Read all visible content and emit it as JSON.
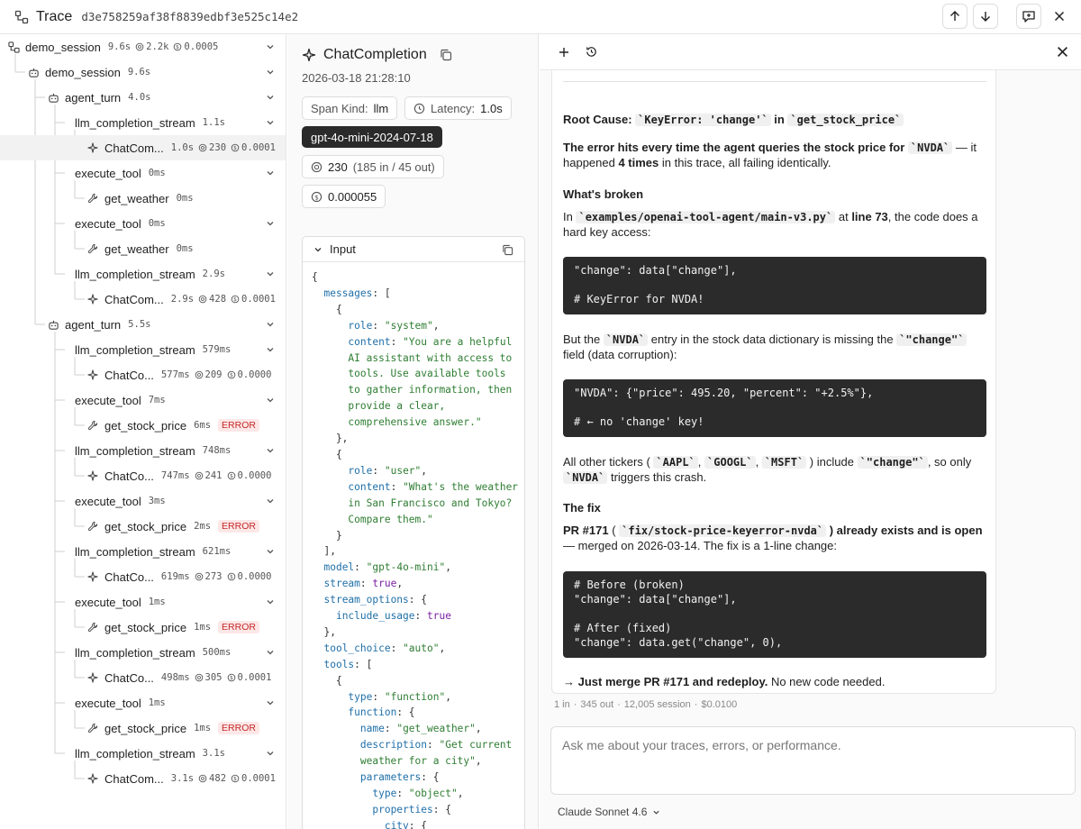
{
  "header": {
    "title": "Trace",
    "trace_id": "d3e758259af38f8839edbf3e525c14e2"
  },
  "tree": [
    {
      "name": "demo_session",
      "dur": "9.6s",
      "tokens": "2.2k",
      "cost": "0.0005",
      "icon": "session-icon",
      "chevron": true
    },
    {
      "name": "demo_session",
      "dur": "9.6s",
      "icon": "agent-icon",
      "chevron": true
    },
    {
      "name": "agent_turn",
      "dur": "4.0s",
      "icon": "agent-icon",
      "chevron": true
    },
    {
      "name": "llm_completion_stream",
      "dur": "1.1s",
      "icon": "branch-icon",
      "chevron": true
    },
    {
      "name": "ChatCom...",
      "dur": "1.0s",
      "tokens": "230",
      "cost": "0.0001",
      "icon": "sparkle-icon",
      "selected": true
    },
    {
      "name": "execute_tool",
      "dur": "0ms",
      "icon": "branch-icon",
      "chevron": true
    },
    {
      "name": "get_weather",
      "dur": "0ms",
      "icon": "wrench-icon"
    },
    {
      "name": "execute_tool",
      "dur": "0ms",
      "icon": "branch-icon",
      "chevron": true
    },
    {
      "name": "get_weather",
      "dur": "0ms",
      "icon": "wrench-icon"
    },
    {
      "name": "llm_completion_stream",
      "dur": "2.9s",
      "icon": "branch-icon",
      "chevron": true
    },
    {
      "name": "ChatCom...",
      "dur": "2.9s",
      "tokens": "428",
      "cost": "0.0001",
      "icon": "sparkle-icon"
    },
    {
      "name": "agent_turn",
      "dur": "5.5s",
      "icon": "agent-icon",
      "chevron": true
    },
    {
      "name": "llm_completion_stream",
      "dur": "579ms",
      "icon": "branch-icon",
      "chevron": true
    },
    {
      "name": "ChatCo...",
      "dur": "577ms",
      "tokens": "209",
      "cost": "0.0000",
      "icon": "sparkle-icon"
    },
    {
      "name": "execute_tool",
      "dur": "7ms",
      "icon": "branch-icon",
      "chevron": true
    },
    {
      "name": "get_stock_price",
      "dur": "6ms",
      "icon": "wrench-icon",
      "error": "ERROR"
    },
    {
      "name": "llm_completion_stream",
      "dur": "748ms",
      "icon": "branch-icon",
      "chevron": true
    },
    {
      "name": "ChatCo...",
      "dur": "747ms",
      "tokens": "241",
      "cost": "0.0000",
      "icon": "sparkle-icon"
    },
    {
      "name": "execute_tool",
      "dur": "3ms",
      "icon": "branch-icon",
      "chevron": true
    },
    {
      "name": "get_stock_price",
      "dur": "2ms",
      "icon": "wrench-icon",
      "error": "ERROR"
    },
    {
      "name": "llm_completion_stream",
      "dur": "621ms",
      "icon": "branch-icon",
      "chevron": true
    },
    {
      "name": "ChatCo...",
      "dur": "619ms",
      "tokens": "273",
      "cost": "0.0000",
      "icon": "sparkle-icon"
    },
    {
      "name": "execute_tool",
      "dur": "1ms",
      "icon": "branch-icon",
      "chevron": true
    },
    {
      "name": "get_stock_price",
      "dur": "1ms",
      "icon": "wrench-icon",
      "error": "ERROR"
    },
    {
      "name": "llm_completion_stream",
      "dur": "500ms",
      "icon": "branch-icon",
      "chevron": true
    },
    {
      "name": "ChatCo...",
      "dur": "498ms",
      "tokens": "305",
      "cost": "0.0001",
      "icon": "sparkle-icon"
    },
    {
      "name": "execute_tool",
      "dur": "1ms",
      "icon": "branch-icon",
      "chevron": true
    },
    {
      "name": "get_stock_price",
      "dur": "1ms",
      "icon": "wrench-icon",
      "error": "ERROR"
    },
    {
      "name": "llm_completion_stream",
      "dur": "3.1s",
      "icon": "branch-icon",
      "chevron": true
    },
    {
      "name": "ChatCom...",
      "dur": "3.1s",
      "tokens": "482",
      "cost": "0.0001",
      "icon": "sparkle-icon"
    }
  ],
  "span": {
    "name": "ChatCompletion",
    "timestamp": "2026-03-18 21:28:10",
    "kind_label": "Span Kind:",
    "kind_value": "llm",
    "latency_label": "Latency:",
    "latency_value": "1.0s",
    "model": "gpt-4o-mini-2024-07-18",
    "tokens_total": "230",
    "tokens_detail": "(185 in / 45 out)",
    "cost": "0.000055",
    "input_label": "Input"
  },
  "input_code": [
    [
      [
        "p",
        "{"
      ]
    ],
    [
      [
        "p",
        "  "
      ],
      [
        "k",
        "messages"
      ],
      [
        "p",
        ": ["
      ]
    ],
    [
      [
        "p",
        "    {"
      ]
    ],
    [
      [
        "p",
        "      "
      ],
      [
        "k",
        "role"
      ],
      [
        "p",
        ": "
      ],
      [
        "s",
        "\"system\""
      ],
      [
        "p",
        ","
      ]
    ],
    [
      [
        "p",
        "      "
      ],
      [
        "k",
        "content"
      ],
      [
        "p",
        ": "
      ],
      [
        "s",
        "\"You are a helpful"
      ]
    ],
    [
      [
        "s",
        "      AI assistant with access to"
      ]
    ],
    [
      [
        "s",
        "      tools. Use available tools"
      ]
    ],
    [
      [
        "s",
        "      to gather information, then"
      ]
    ],
    [
      [
        "s",
        "      provide a clear,"
      ]
    ],
    [
      [
        "s",
        "      comprehensive answer.\""
      ]
    ],
    [
      [
        "p",
        "    },"
      ]
    ],
    [
      [
        "p",
        "    {"
      ]
    ],
    [
      [
        "p",
        "      "
      ],
      [
        "k",
        "role"
      ],
      [
        "p",
        ": "
      ],
      [
        "s",
        "\"user\""
      ],
      [
        "p",
        ","
      ]
    ],
    [
      [
        "p",
        "      "
      ],
      [
        "k",
        "content"
      ],
      [
        "p",
        ": "
      ],
      [
        "s",
        "\"What's the weather"
      ]
    ],
    [
      [
        "s",
        "      in San Francisco and Tokyo?"
      ]
    ],
    [
      [
        "s",
        "      Compare them.\""
      ]
    ],
    [
      [
        "p",
        "    }"
      ]
    ],
    [
      [
        "p",
        "  ],"
      ]
    ],
    [
      [
        "p",
        "  "
      ],
      [
        "k",
        "model"
      ],
      [
        "p",
        ": "
      ],
      [
        "s",
        "\"gpt-4o-mini\""
      ],
      [
        "p",
        ","
      ]
    ],
    [
      [
        "p",
        "  "
      ],
      [
        "k",
        "stream"
      ],
      [
        "p",
        ": "
      ],
      [
        "kw",
        "true"
      ],
      [
        "p",
        ","
      ]
    ],
    [
      [
        "p",
        "  "
      ],
      [
        "k",
        "stream_options"
      ],
      [
        "p",
        ": {"
      ]
    ],
    [
      [
        "p",
        "    "
      ],
      [
        "k",
        "include_usage"
      ],
      [
        "p",
        ": "
      ],
      [
        "kw",
        "true"
      ]
    ],
    [
      [
        "p",
        "  },"
      ]
    ],
    [
      [
        "p",
        "  "
      ],
      [
        "k",
        "tool_choice"
      ],
      [
        "p",
        ": "
      ],
      [
        "s",
        "\"auto\""
      ],
      [
        "p",
        ","
      ]
    ],
    [
      [
        "p",
        "  "
      ],
      [
        "k",
        "tools"
      ],
      [
        "p",
        ": ["
      ]
    ],
    [
      [
        "p",
        "    {"
      ]
    ],
    [
      [
        "p",
        "      "
      ],
      [
        "k",
        "type"
      ],
      [
        "p",
        ": "
      ],
      [
        "s",
        "\"function\""
      ],
      [
        "p",
        ","
      ]
    ],
    [
      [
        "p",
        "      "
      ],
      [
        "k",
        "function"
      ],
      [
        "p",
        ": {"
      ]
    ],
    [
      [
        "p",
        "        "
      ],
      [
        "k",
        "name"
      ],
      [
        "p",
        ": "
      ],
      [
        "s",
        "\"get_weather\""
      ],
      [
        "p",
        ","
      ]
    ],
    [
      [
        "p",
        "        "
      ],
      [
        "k",
        "description"
      ],
      [
        "p",
        ": "
      ],
      [
        "s",
        "\"Get current"
      ]
    ],
    [
      [
        "s",
        "        weather for a city\""
      ],
      [
        "p",
        ","
      ]
    ],
    [
      [
        "p",
        "        "
      ],
      [
        "k",
        "parameters"
      ],
      [
        "p",
        ": {"
      ]
    ],
    [
      [
        "p",
        "          "
      ],
      [
        "k",
        "type"
      ],
      [
        "p",
        ": "
      ],
      [
        "s",
        "\"object\""
      ],
      [
        "p",
        ","
      ]
    ],
    [
      [
        "p",
        "          "
      ],
      [
        "k",
        "properties"
      ],
      [
        "p",
        ": {"
      ]
    ],
    [
      [
        "p",
        "            "
      ],
      [
        "k",
        "city"
      ],
      [
        "p",
        ": {"
      ]
    ]
  ],
  "chat": {
    "root_cause_prefix": "Root Cause: ",
    "root_cause_code1": "`KeyError: 'change'`",
    "root_cause_in": " in ",
    "root_cause_code2": "`get_stock_price`",
    "p1_a": "The error hits every time the agent queries the stock price for ",
    "p1_code": "`NVDA`",
    "p1_b": " — it happened ",
    "p1_bold": "4 times",
    "p1_c": " in this trace, all failing identically.",
    "h_broken": "What's broken",
    "p2_a": "In ",
    "p2_code": "`examples/openai-tool-agent/main-v3.py`",
    "p2_b": " at ",
    "p2_bold": "line 73",
    "p2_c": ", the code does a hard key access:",
    "code1": "\"change\": data[\"change\"],\n\n# KeyError for NVDA!",
    "p3_a": "But the ",
    "p3_code1": "`NVDA`",
    "p3_b": " entry in the stock data dictionary is missing the ",
    "p3_code2": "`\"change\"`",
    "p3_c": " field (data corruption):",
    "code2": "\"NVDA\": {\"price\": 495.20, \"percent\": \"+2.5%\"},\n\n# ← no 'change' key!",
    "p4_a": "All other tickers ( ",
    "p4_t1": "`AAPL`",
    "p4_t2": "`GOOGL`",
    "p4_t3": "`MSFT`",
    "p4_b": " ) include ",
    "p4_code": "`\"change\"`",
    "p4_c": ", so only ",
    "p4_code2": "`NVDA`",
    "p4_d": " triggers this crash.",
    "h_fix": "The fix",
    "p5_bold1": "PR #171",
    "p5_a": " ( ",
    "p5_code": "`fix/stock-price-keyerror-nvda`",
    "p5_bold2": " ) already exists and is open",
    "p5_b": " — merged on 2026-03-14. The fix is a 1-line change:",
    "code3": "# Before (broken)\n\"change\": data[\"change\"],\n\n# After (fixed)\n\"change\": data.get(\"change\", 0),",
    "p6_bold": "→ Just merge PR #171 and redeploy.",
    "p6_rest": " No new code needed.",
    "stats": [
      "1 in",
      "·",
      "345 out",
      "·",
      "12,005 session",
      "·",
      "$0.0100"
    ],
    "placeholder": "Ask me about your traces, errors, or performance.",
    "model_label": "Claude Sonnet 4.6"
  }
}
